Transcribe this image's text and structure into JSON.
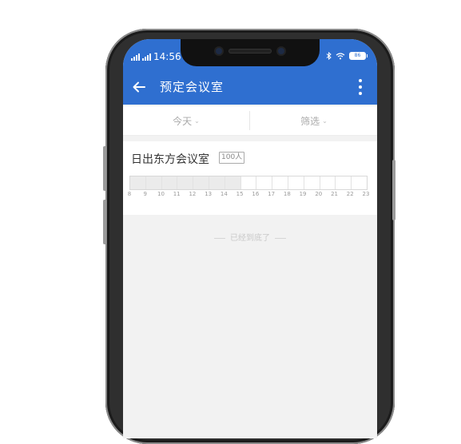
{
  "status_bar": {
    "signal_text": "ᵎᵎll",
    "signal2_text": "4G",
    "time": "14:56",
    "battery": "86",
    "icons": [
      "signal-icon",
      "bluetooth-icon",
      "wifi-icon",
      "battery-icon"
    ]
  },
  "app_bar": {
    "title": "预定会议室",
    "back_icon": "arrow-left-icon",
    "menu_icon": "more-vertical-icon"
  },
  "filters": [
    {
      "label": "今天",
      "caret": "⌄"
    },
    {
      "label": "筛选",
      "caret": "⌄"
    }
  ],
  "room": {
    "name": "日出东方会议室",
    "capacity": "100人",
    "hours": [
      "8",
      "9",
      "10",
      "11",
      "12",
      "13",
      "14",
      "15",
      "16",
      "17",
      "18",
      "19",
      "20",
      "21",
      "22",
      "23"
    ],
    "busy_slots": [
      true,
      true,
      true,
      true,
      true,
      true,
      true,
      false,
      false,
      false,
      false,
      false,
      false,
      false,
      false
    ]
  },
  "list_end_text": "已经到底了",
  "colors": {
    "primary": "#2f6fd0",
    "background": "#f2f2f2"
  }
}
